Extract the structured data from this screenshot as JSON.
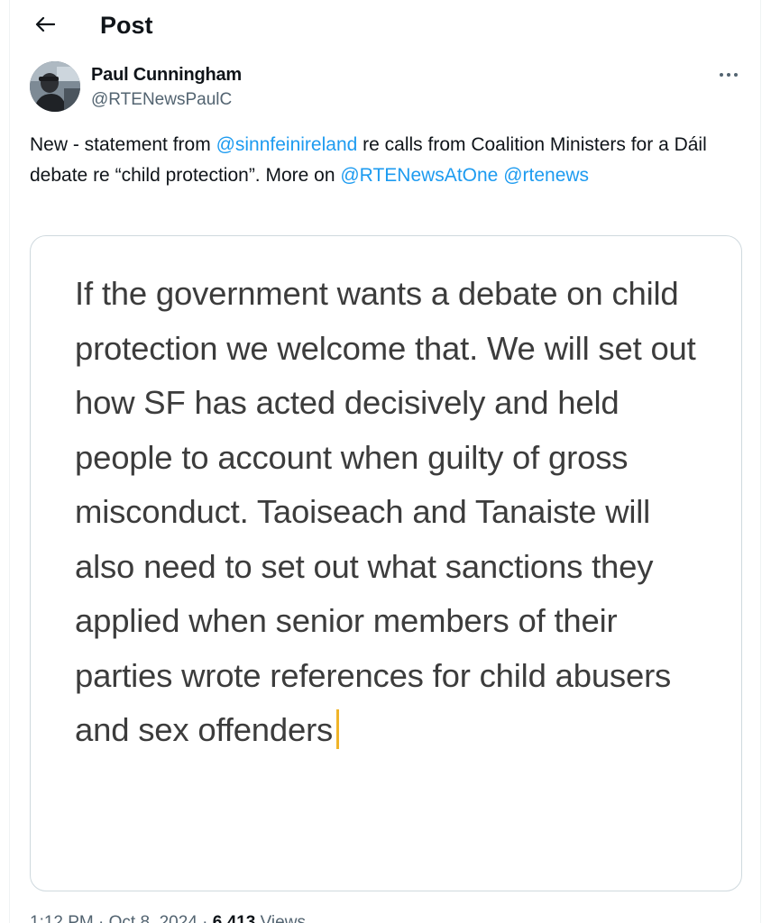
{
  "header": {
    "title": "Post"
  },
  "author": {
    "display_name": "Paul Cunningham",
    "handle": "@RTENewsPaulC"
  },
  "tweet": {
    "text_parts": {
      "p1": "New - statement from ",
      "m1": "@sinnfeinireland",
      "p2": " re calls from Coalition Ministers for a Dáil debate re “child protection”. More on ",
      "m2": "@RTENewsAtOne",
      "p3": " ",
      "m3": "@rtenews"
    }
  },
  "card": {
    "text": "If the government wants a debate on child protection we welcome that. We will set out how SF has acted decisively and held people to account when guilty of gross misconduct. Taoiseach and Tanaiste will also need to set out what sanctions they applied when senior members of their parties wrote references for child abusers and sex offenders"
  },
  "meta": {
    "time": "1:12 PM",
    "separator": " · ",
    "date": "Oct 8, 2024",
    "views_count": "6,413",
    "views_label": " Views"
  },
  "icons": {
    "back": "arrow-left-icon",
    "more": "more-horizontal-icon"
  },
  "colors": {
    "link": "#1d9bf0",
    "secondary_text": "#536471",
    "primary_text": "#0f1419",
    "card_border": "#cfd9de",
    "cursor": "#f0b429"
  }
}
